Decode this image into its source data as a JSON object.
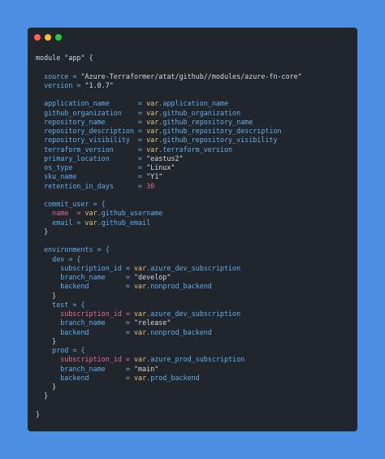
{
  "window": {
    "controls": [
      {
        "name": "close",
        "color": "#fe5f57"
      },
      {
        "name": "minimize",
        "color": "#febc2e"
      },
      {
        "name": "maximize",
        "color": "#28c840"
      }
    ]
  },
  "code": {
    "lines": [
      [
        {
          "t": "module \"app\" {",
          "c": "plain"
        }
      ],
      [],
      [
        {
          "t": "  source = ",
          "c": "key"
        },
        {
          "t": "\"Azure-Terraformer/atat/github//modules/azure-fn-core\"",
          "c": "str"
        }
      ],
      [
        {
          "t": "  version = ",
          "c": "key"
        },
        {
          "t": "\"1.0.7\"",
          "c": "str"
        }
      ],
      [],
      [
        {
          "t": "  application_name       = ",
          "c": "key"
        },
        {
          "t": "var",
          "c": "var"
        },
        {
          "t": ".application_name",
          "c": "attr"
        }
      ],
      [
        {
          "t": "  github_organization    = ",
          "c": "key"
        },
        {
          "t": "var",
          "c": "var"
        },
        {
          "t": ".github_organization",
          "c": "attr"
        }
      ],
      [
        {
          "t": "  repository_name        = ",
          "c": "key"
        },
        {
          "t": "var",
          "c": "var"
        },
        {
          "t": ".github_repository_name",
          "c": "attr"
        }
      ],
      [
        {
          "t": "  repository_description = ",
          "c": "key"
        },
        {
          "t": "var",
          "c": "var"
        },
        {
          "t": ".github_repository_description",
          "c": "attr"
        }
      ],
      [
        {
          "t": "  repository_visibility  = ",
          "c": "key"
        },
        {
          "t": "var",
          "c": "var"
        },
        {
          "t": ".github_repository_visibility",
          "c": "attr"
        }
      ],
      [
        {
          "t": "  terraform_version      = ",
          "c": "key"
        },
        {
          "t": "var",
          "c": "var"
        },
        {
          "t": ".terraform_version",
          "c": "attr"
        }
      ],
      [
        {
          "t": "  primary_location       = ",
          "c": "key"
        },
        {
          "t": "\"eastus2\"",
          "c": "str"
        }
      ],
      [
        {
          "t": "  os_type                = ",
          "c": "key"
        },
        {
          "t": "\"Linux\"",
          "c": "str"
        }
      ],
      [
        {
          "t": "  sku_name               = ",
          "c": "key"
        },
        {
          "t": "\"Y1\"",
          "c": "str"
        }
      ],
      [
        {
          "t": "  retention_in_days      = ",
          "c": "key"
        },
        {
          "t": "30",
          "c": "num"
        }
      ],
      [],
      [
        {
          "t": "  commit_user = {",
          "c": "key"
        }
      ],
      [
        {
          "t": "    name  = ",
          "c": "pink"
        },
        {
          "t": "var",
          "c": "var"
        },
        {
          "t": ".github_username",
          "c": "attr"
        }
      ],
      [
        {
          "t": "    email = ",
          "c": "key"
        },
        {
          "t": "var",
          "c": "var"
        },
        {
          "t": ".github_email",
          "c": "attr"
        }
      ],
      [
        {
          "t": "  }",
          "c": "plain"
        }
      ],
      [],
      [
        {
          "t": "  environments = {",
          "c": "key"
        }
      ],
      [
        {
          "t": "    dev = {",
          "c": "key"
        }
      ],
      [
        {
          "t": "      subscription_id = ",
          "c": "key"
        },
        {
          "t": "var",
          "c": "var"
        },
        {
          "t": ".azure_dev_subscription",
          "c": "attr"
        }
      ],
      [
        {
          "t": "      branch_name     = ",
          "c": "key"
        },
        {
          "t": "\"develop\"",
          "c": "str"
        }
      ],
      [
        {
          "t": "      backend         = ",
          "c": "key"
        },
        {
          "t": "var",
          "c": "var"
        },
        {
          "t": ".nonprod_backend",
          "c": "attr"
        }
      ],
      [
        {
          "t": "    }",
          "c": "plain"
        }
      ],
      [
        {
          "t": "    test = {",
          "c": "key"
        }
      ],
      [
        {
          "t": "      subscription_id = ",
          "c": "pink"
        },
        {
          "t": "var",
          "c": "var"
        },
        {
          "t": ".azure_dev_subscription",
          "c": "attr"
        }
      ],
      [
        {
          "t": "      branch_name     = ",
          "c": "key"
        },
        {
          "t": "\"release\"",
          "c": "str"
        }
      ],
      [
        {
          "t": "      backend         = ",
          "c": "key"
        },
        {
          "t": "var",
          "c": "var"
        },
        {
          "t": ".nonprod_backend",
          "c": "attr"
        }
      ],
      [
        {
          "t": "    }",
          "c": "plain"
        }
      ],
      [
        {
          "t": "    prod = {",
          "c": "key"
        }
      ],
      [
        {
          "t": "      subscription_id = ",
          "c": "pink"
        },
        {
          "t": "var",
          "c": "var"
        },
        {
          "t": ".azure_prod_subscription",
          "c": "attr"
        }
      ],
      [
        {
          "t": "      branch_name     = ",
          "c": "key"
        },
        {
          "t": "\"main\"",
          "c": "str"
        }
      ],
      [
        {
          "t": "      backend         = ",
          "c": "key"
        },
        {
          "t": "var",
          "c": "var"
        },
        {
          "t": ".prod_backend",
          "c": "attr"
        }
      ],
      [
        {
          "t": "    }",
          "c": "plain"
        }
      ],
      [
        {
          "t": "  }",
          "c": "plain"
        }
      ],
      [],
      [
        {
          "t": "}",
          "c": "plain"
        }
      ]
    ]
  }
}
